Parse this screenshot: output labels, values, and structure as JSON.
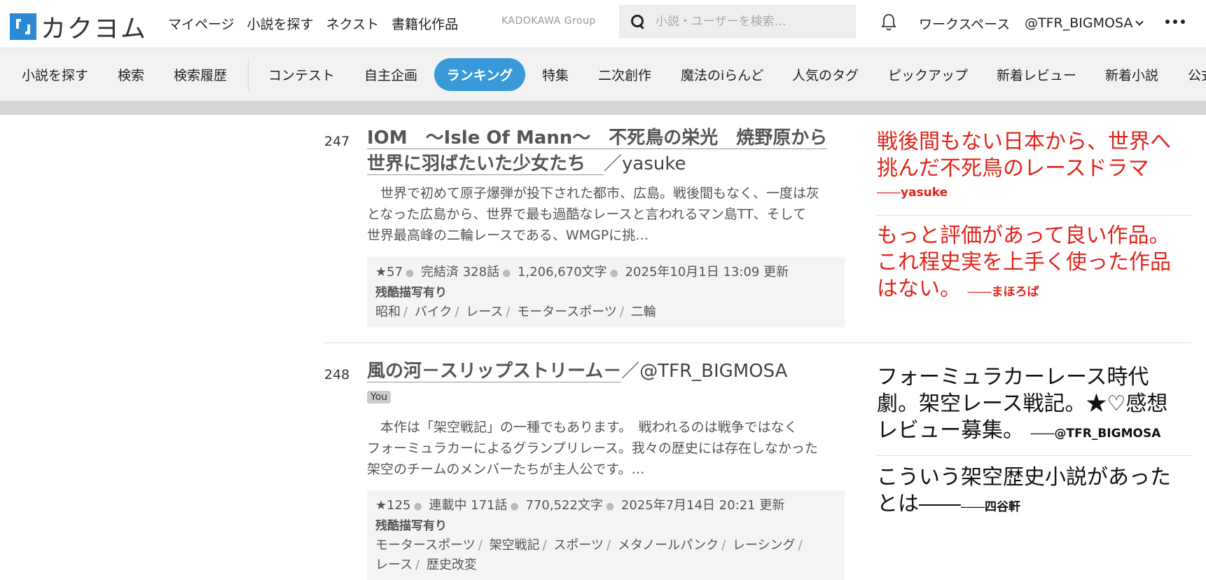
{
  "header": {
    "logo_text": "カクヨム",
    "nav": [
      "マイページ",
      "小説を探す",
      "ネクスト",
      "書籍化作品"
    ],
    "group_label": "KADOKAWA Group",
    "search_placeholder": "小説・ユーザーを検索…",
    "workspace": "ワークスペース",
    "user": "@TFR_BIGMOSA"
  },
  "subnav": {
    "items": [
      "小説を探す",
      "検索",
      "検索履歴",
      "コンテスト",
      "自主企画",
      "ランキング",
      "特集",
      "二次創作",
      "魔法のiらんど",
      "人気のタグ",
      "ピックアップ",
      "新着レビュー",
      "新着小説",
      "公式"
    ],
    "active": "ランキング"
  },
  "works": [
    {
      "rank": "247",
      "title_line1": "IOM　～Isle Of Mann～　不死鳥の栄光　焼野原から",
      "title_line2": "世界に羽ばたいた少女たち　",
      "author": "／yasuke",
      "desc_lines": [
        "　世界で初めて原子爆弾が投下された都市、広島。戦後間もなく、一度は灰",
        "となった広島から、世界で最も過酷なレースと言われるマン島TT、そして",
        "世界最高峰の二輪レースである、WMGPに挑…"
      ],
      "stars": "★57",
      "status": "完結済 328話",
      "chars": "1,206,670文字",
      "updated": "2025年10月1日 13:09 更新",
      "warning": "残酷描写有り",
      "tags": [
        "昭和",
        "バイク",
        "レース",
        "モータースポーツ",
        "二輪"
      ],
      "reviews": [
        {
          "text_lines": [
            "戦後間もない日本から、世界へ",
            "挑んだ不死鳥のレースドラマ"
          ],
          "by": "yasuke"
        },
        {
          "text_lines": [
            "もっと評価があって良い作品。",
            "これ程史実を上手く使った作品",
            "はない。"
          ],
          "by": "まほろば"
        }
      ]
    },
    {
      "rank": "248",
      "title_line1": "風の河－スリップストリーム－",
      "author": "／@TFR_BIGMOSA",
      "you_badge": "You",
      "desc_lines": [
        "　本作は「架空戦記」の一種でもあります。　戦われるのは戦争ではなく",
        "フォーミュラカーによるグランプリレース。我々の歴史には存在しなかった",
        "架空のチームのメンバーたちが主人公です。…"
      ],
      "stars": "★125",
      "status": "連載中 171話",
      "chars": "770,522文字",
      "updated": "2025年7月14日 20:21 更新",
      "warning": "残酷描写有り",
      "tags_line1": [
        "モータースポーツ",
        "架空戦記",
        "スポーツ",
        "メタノールパンク",
        "レーシング"
      ],
      "tags_line2": [
        "レース",
        "歴史改変"
      ],
      "reviews": [
        {
          "text_lines": [
            "フォーミュラカーレース時代",
            "劇。架空レース戦記。★♡感想",
            "レビュー募集。"
          ],
          "by": "@TFR_BIGMOSA"
        },
        {
          "text_lines": [
            "こういう架空歴史小説があった",
            "とは――"
          ],
          "by": "四谷軒"
        }
      ]
    }
  ],
  "colors": {
    "accent": "#3a9ad9",
    "review_red": "#e0251b",
    "logo_blue": "#2b8ad7"
  }
}
